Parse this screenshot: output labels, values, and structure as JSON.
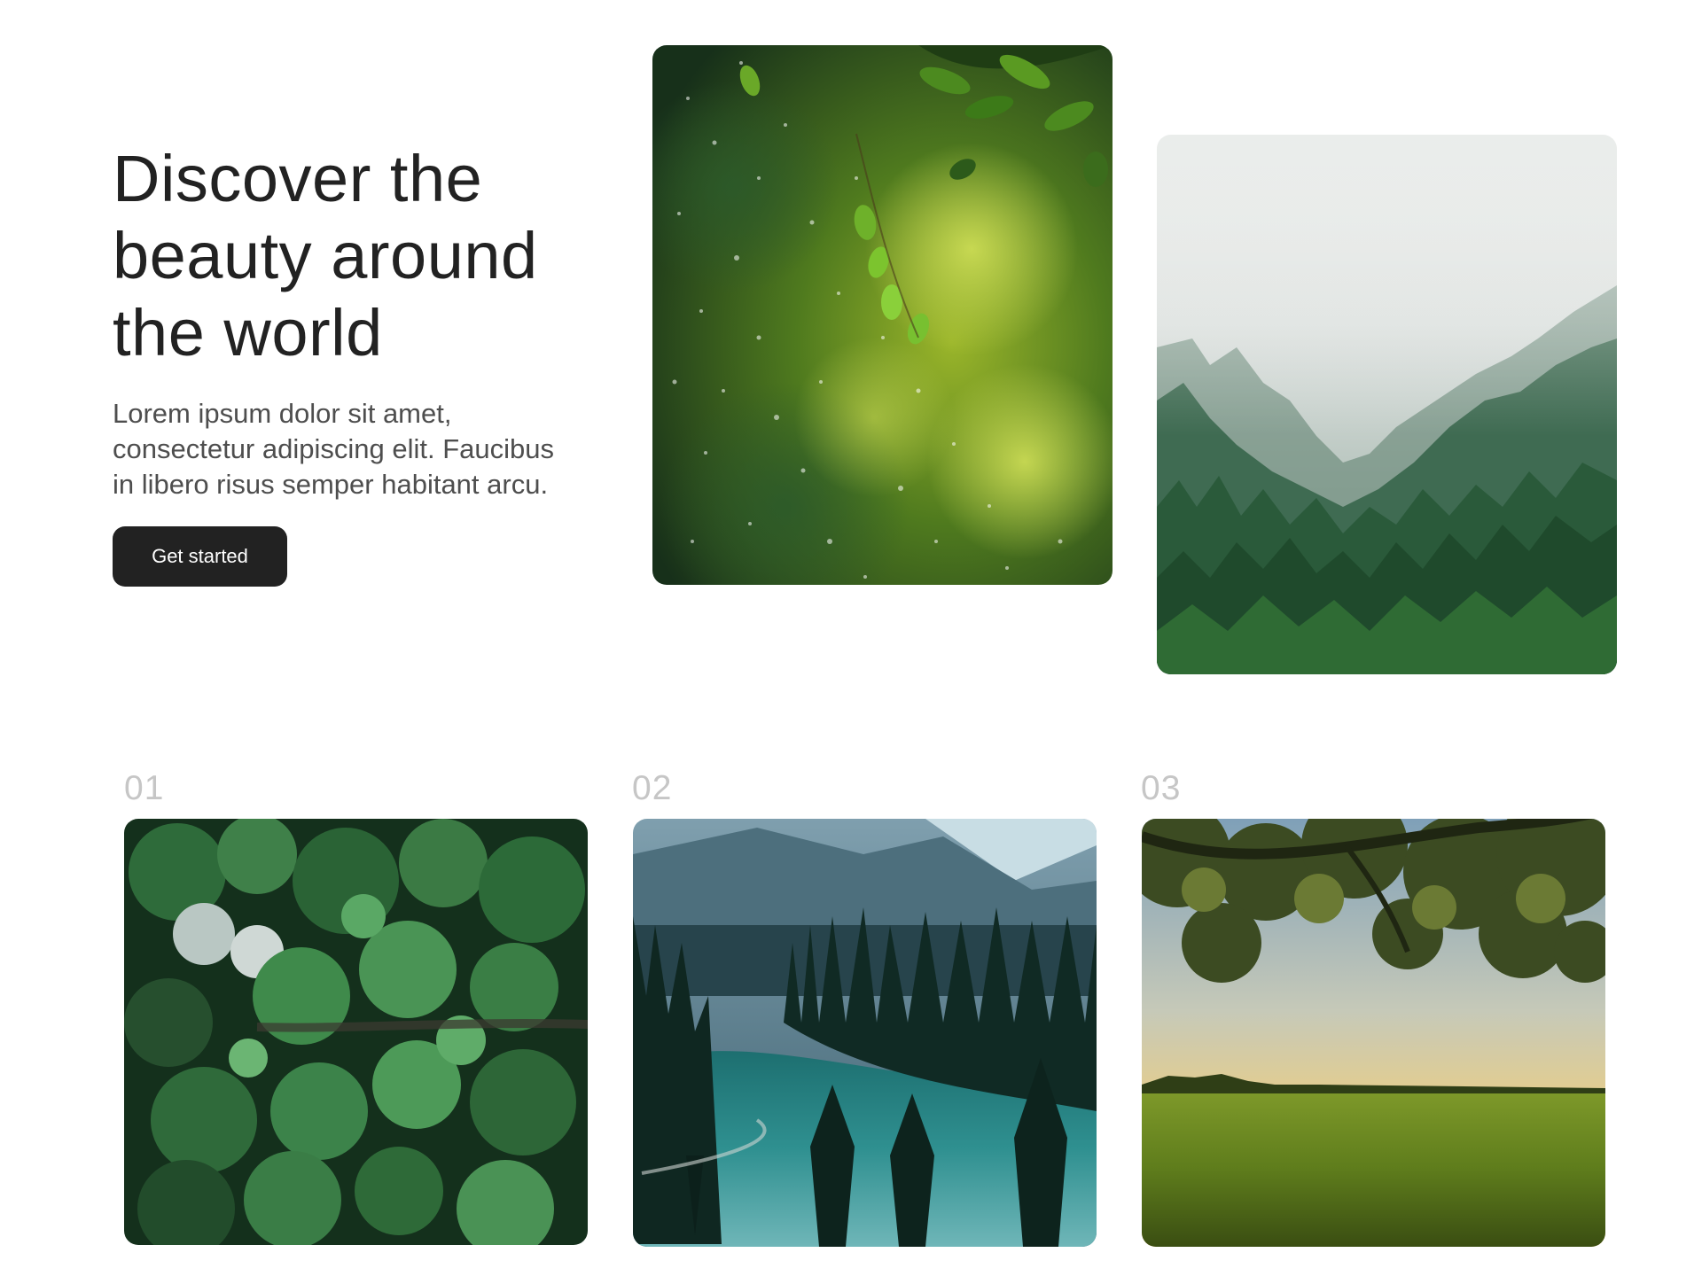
{
  "hero": {
    "title_lines": [
      "Discover the",
      "beauty around",
      "the world"
    ],
    "body_lines": [
      "Lorem ipsum dolor sit amet,",
      "consectetur adipiscing elit. Faucibus",
      "in libero risus semper habitant arcu."
    ],
    "cta_label": "Get started"
  },
  "gallery": [
    {
      "number": "01"
    },
    {
      "number": "02"
    },
    {
      "number": "03"
    }
  ],
  "colors": {
    "text": "#222222",
    "body_text": "#4e4e4e",
    "button_bg": "#222222",
    "number": "#c6c6c6"
  }
}
